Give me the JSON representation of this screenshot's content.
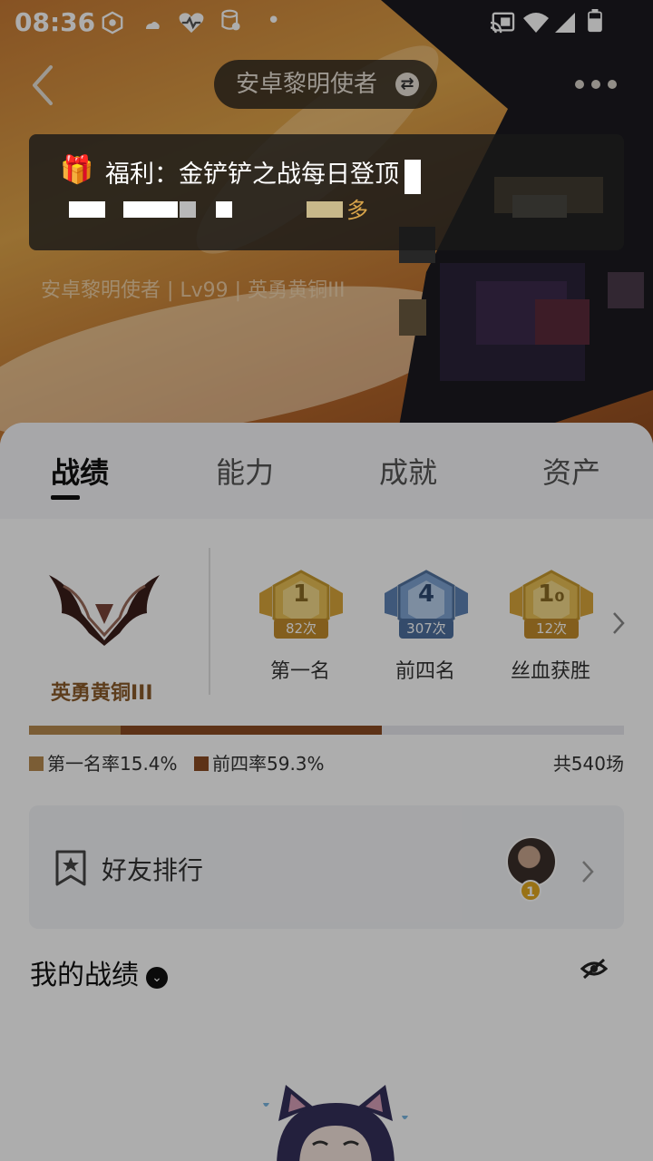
{
  "status_bar": {
    "time": "08:36"
  },
  "header": {
    "account_name": "安卓黎明使者",
    "subline": "安卓黎明使者 | Lv99 | 英勇黄铜III"
  },
  "toast": {
    "title": "福利：金铲铲之战每日登顶",
    "suffix": "多"
  },
  "tabs": [
    {
      "label": "战绩",
      "active": true
    },
    {
      "label": "能力",
      "active": false
    },
    {
      "label": "成就",
      "active": false
    },
    {
      "label": "资产",
      "active": false
    }
  ],
  "rank": {
    "name": "英勇黄铜III"
  },
  "medals": [
    {
      "label": "第一名",
      "count": "82次",
      "glyph": "1",
      "color": "#e2b13c"
    },
    {
      "label": "前四名",
      "count": "307次",
      "glyph": "4",
      "color": "#6f93c4"
    },
    {
      "label": "丝血获胜",
      "count": "12次",
      "glyph": "1₀",
      "color": "#e2b13c"
    }
  ],
  "stats": {
    "first_rate_label": "第一名率15.4%",
    "top4_rate_label": "前四率59.3%",
    "first_rate": 15.4,
    "top4_rate": 59.3,
    "total": "共540场",
    "colors": {
      "first": "#b58a4e",
      "top4": "#8a4a22"
    }
  },
  "friends": {
    "label": "好友排行",
    "rank": "1"
  },
  "my_record": {
    "title": "我的战绩"
  }
}
